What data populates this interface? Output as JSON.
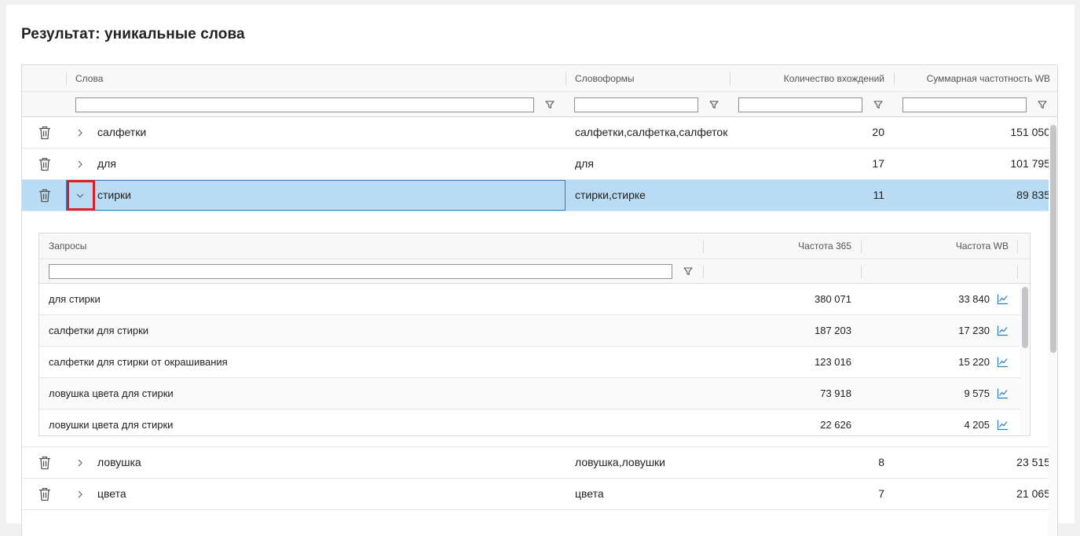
{
  "page": {
    "title": "Результат: уникальные слова"
  },
  "grid": {
    "columns": {
      "words": "Слова",
      "wordforms": "Словоформы",
      "count": "Количество вхождений",
      "freq_wb": "Суммарная частотность WB"
    },
    "filters": {
      "words": "",
      "wordforms": "",
      "count": "",
      "freq_wb": ""
    },
    "rows": [
      {
        "word": "салфетки",
        "forms": "салфетки,салфетка,салфеток",
        "count": "20",
        "freq": "151 050"
      },
      {
        "word": "для",
        "forms": "для",
        "count": "17",
        "freq": "101 795"
      },
      {
        "word": "стирки",
        "forms": "стирки,стирке",
        "count": "11",
        "freq": "89 835",
        "expanded": true,
        "selected": true
      },
      {
        "word": "ловушка",
        "forms": "ловушка,ловушки",
        "count": "8",
        "freq": "23 515"
      },
      {
        "word": "цвета",
        "forms": "цвета",
        "count": "7",
        "freq": "21 065"
      }
    ]
  },
  "detail": {
    "columns": {
      "queries": "Запросы",
      "freq365": "Частота 365",
      "freq_wb": "Частота WB"
    },
    "filters": {
      "queries": ""
    },
    "rows": [
      {
        "query": "для стирки",
        "f365": "380 071",
        "fwb": "33 840"
      },
      {
        "query": "салфетки для стирки",
        "f365": "187 203",
        "fwb": "17 230"
      },
      {
        "query": "салфетки для стирки от окрашивания",
        "f365": "123 016",
        "fwb": "15 220"
      },
      {
        "query": "ловушка цвета для стирки",
        "f365": "73 918",
        "fwb": "9 575"
      },
      {
        "query": "ловушки цвета для стирки",
        "f365": "22 626",
        "fwb": "4 205"
      }
    ]
  },
  "colors": {
    "accent": "#2a7fc4",
    "selected_row": "#b9dcf4",
    "highlight": "#e01b22",
    "icon": "#555555"
  },
  "icons": {
    "delete": "trash-icon",
    "expand": "chevron-right-icon",
    "collapse": "chevron-down-icon",
    "filter": "filter-icon",
    "chart": "line-chart-icon"
  }
}
